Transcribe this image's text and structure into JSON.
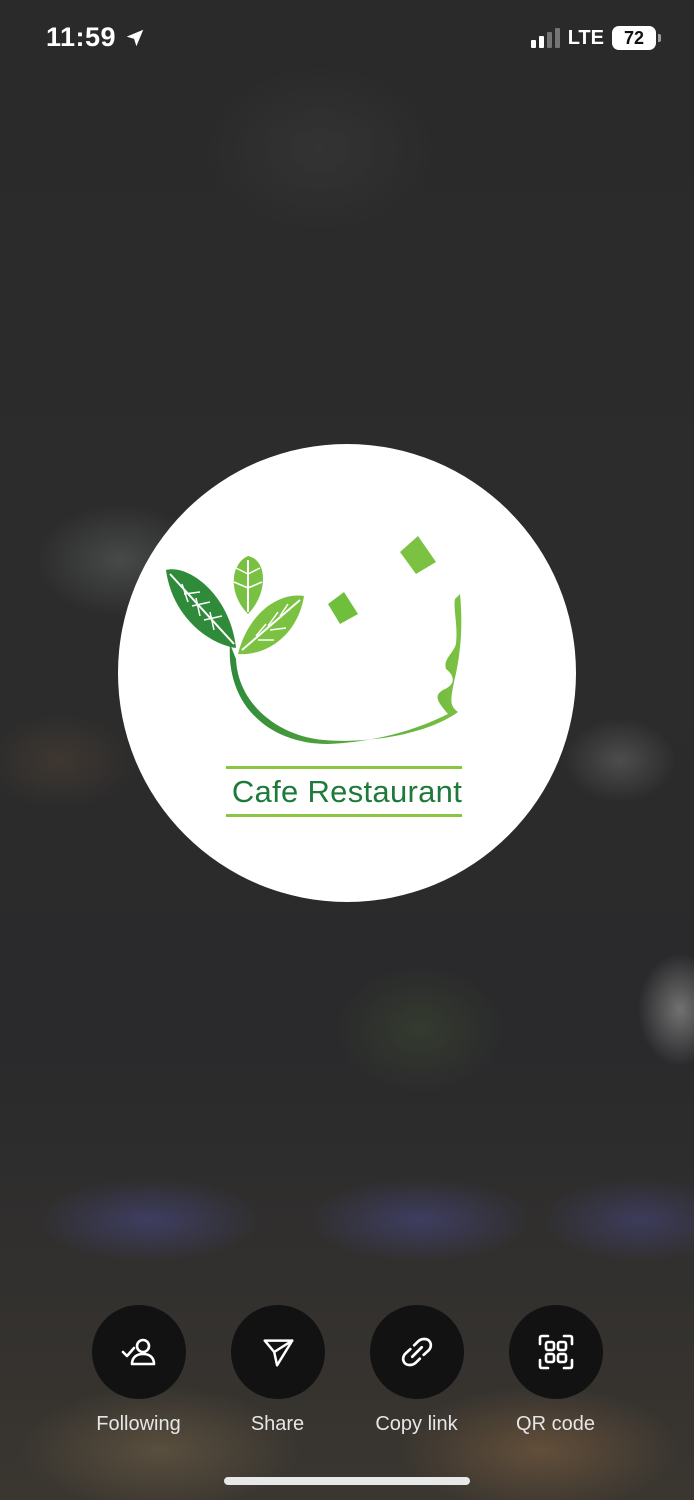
{
  "status_bar": {
    "time": "11:59",
    "network": "LTE",
    "battery": "72"
  },
  "profile": {
    "logo_text": "Cafe Restaurant",
    "logo_color": "#1d7a3a",
    "accent_green": "#8ac63f"
  },
  "actions": [
    {
      "label": "Following",
      "icon": "following-person-check-icon"
    },
    {
      "label": "Share",
      "icon": "share-paper-plane-icon"
    },
    {
      "label": "Copy link",
      "icon": "link-icon"
    },
    {
      "label": "QR code",
      "icon": "qr-code-icon"
    }
  ]
}
